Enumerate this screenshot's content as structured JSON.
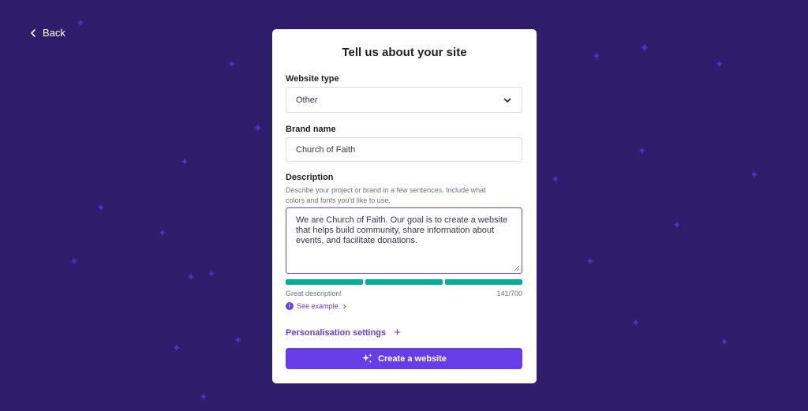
{
  "nav": {
    "back_label": "Back"
  },
  "form": {
    "title": "Tell us about your site",
    "website_type": {
      "label": "Website type",
      "value": "Other"
    },
    "brand_name": {
      "label": "Brand name",
      "value": "Church of Faith"
    },
    "description": {
      "label": "Description",
      "hint": "Describe your project or brand in a few sentences. Include what colors and fonts you'd like to use.",
      "value": "We are Church of Faith. Our goal is to create a website that helps build community, share information about events, and facilitate donations.",
      "quality_label": "Great description!",
      "char_count": "141/700",
      "quality_level": 1.0
    },
    "see_example_label": "See example",
    "personalisation_label": "Personalisation settings",
    "create_label": "Create a website"
  },
  "colors": {
    "background": "#2f1c6a",
    "accent": "#673de6",
    "success": "#00b090"
  }
}
